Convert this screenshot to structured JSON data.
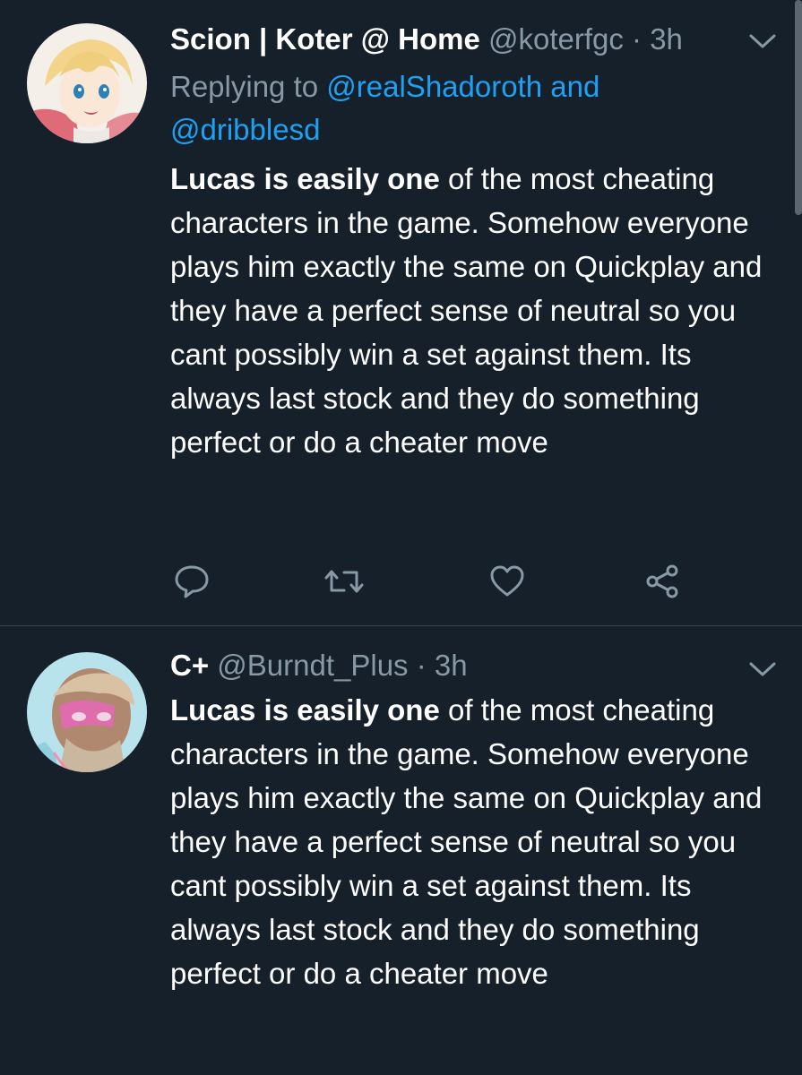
{
  "tweets": [
    {
      "name": "Scion | Koter @ Home",
      "handle": "@koterfgc",
      "sep": "·",
      "time": "3h",
      "replying_to_prefix": "Replying to",
      "mention_1": "@realShadoroth",
      "and_text": "and",
      "mention_2": "@dribblesd",
      "body_bold": "Lucas is easily one",
      "body_rest": "of the most cheating characters in the game. Somehow everyone plays him exactly the same on Quickplay and they have a perfect sense of neutral so you cant possibly win a set against them. Its always last stock and they do something perfect or do a cheater move",
      "avatar_icon": "anime-avatar-icon"
    },
    {
      "name": "C+",
      "handle": "@Burndt_Plus",
      "sep": "·",
      "time": "3h",
      "body_bold": "Lucas is easily one",
      "body_rest": "of the most cheating characters in the game. Somehow everyone plays him exactly the same on Quickplay and they have a perfect sense of neutral so you cant possibly win a set against them. Its always last stock and they do something perfect or do a cheater move",
      "avatar_icon": "photo-avatar-icon"
    }
  ],
  "actions": {
    "reply_icon": "reply-icon",
    "retweet_icon": "retweet-icon",
    "like_icon": "heart-icon",
    "share_icon": "share-icon"
  },
  "colors": {
    "background": "#15202b",
    "secondary_text": "#8899a6",
    "link": "#1da1f2",
    "divider": "#38444d"
  }
}
